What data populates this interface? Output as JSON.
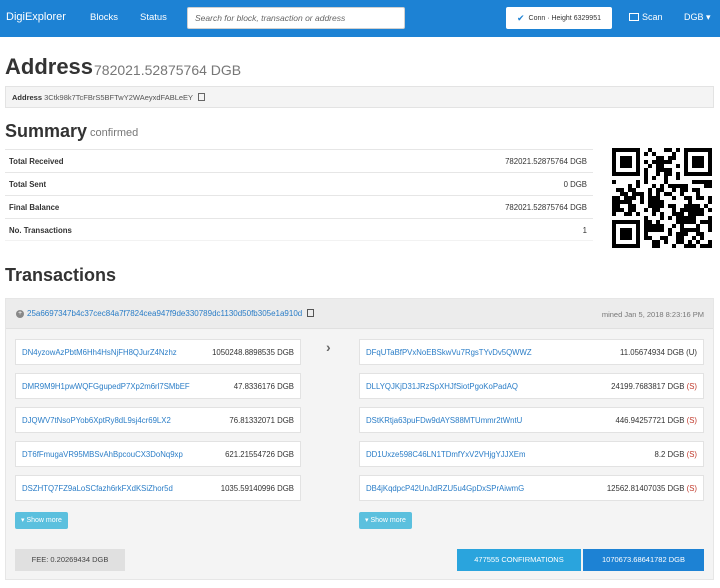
{
  "navbar": {
    "brand": "DigiExplorer",
    "links": [
      "Blocks",
      "Status"
    ],
    "search_placeholder": "Search for block, transaction or address",
    "conn_label": "Conn · Height",
    "conn_height": "6329951",
    "scan_label": "Scan",
    "currency": "DGB ▾"
  },
  "address": {
    "heading": "Address",
    "balance": "782021.52875764 DGB",
    "label": "Address",
    "value": "3Ctk98k7TcFBrS5BFTwY2WAeyxdFABLeEY"
  },
  "summary": {
    "heading": "Summary",
    "status": "confirmed",
    "rows": [
      {
        "label": "Total Received",
        "value": "782021.52875764 DGB"
      },
      {
        "label": "Total Sent",
        "value": "0 DGB"
      },
      {
        "label": "Final Balance",
        "value": "782021.52875764 DGB"
      },
      {
        "label": "No. Transactions",
        "value": "1"
      }
    ]
  },
  "transactions": {
    "heading": "Transactions",
    "txid": "25a6697347b4c37cec84a7f7824cea947f9de330789dc1130d50fb305e1a910d",
    "mined": "mined Jan 5, 2018 8:23:16 PM",
    "inputs": [
      {
        "address": "DN4yzowAzPbtM6Hh4HsNjFH8QJurZ4Nzhz",
        "amount": "1050248.8898535 DGB"
      },
      {
        "address": "DMR9M9H1pwWQFGgupedP7Xp2m6rl7SMbEF",
        "amount": "47.8336176 DGB"
      },
      {
        "address": "DJQWV7tNsoPYob6XptRy8dL9sj4cr69LX2",
        "amount": "76.81332071 DGB"
      },
      {
        "address": "DT6fFmugaVR95MBSvAhBpcouCX3DoNq9xp",
        "amount": "621.21554726 DGB"
      },
      {
        "address": "DSZHTQ7FZ9aLoSCfazh6rkFXdKSiZhor5d",
        "amount": "1035.59140996 DGB"
      }
    ],
    "outputs": [
      {
        "address": "DFqUTaBfPVxNoEBSkwVu7RgsTYvDv5QWWZ",
        "amount": "11.05674934 DGB",
        "status": "(U)"
      },
      {
        "address": "DLLYQJKjD31JRzSpXHJfSiotPgoKoPadAQ",
        "amount": "24199.7683817 DGB",
        "status": "(S)"
      },
      {
        "address": "DStKRtja63puFDw9dAYS88MTUmmr2tWntU",
        "amount": "446.94257721 DGB",
        "status": "(S)"
      },
      {
        "address": "DD1Uxze598C46LN1TDmfYxV2VHjgYJJXEm",
        "amount": "8.2 DGB",
        "status": "(S)"
      },
      {
        "address": "DB4jKqdpcP42UnJdRZU5u4GpDxSPrAiwmG",
        "amount": "12562.81407035 DGB",
        "status": "(S)"
      }
    ],
    "show_more": "Show more",
    "fee": "FEE: 0.20269434 DGB",
    "confirmations": "477555 CONFIRMATIONS",
    "total": "1070673.68641782 DGB"
  },
  "colors": {
    "navbar": "#1d82d4",
    "link": "#2a7dc7",
    "confirm": "#2aa4dd",
    "show_more": "#5bc0de",
    "spent": "#c0392b"
  }
}
